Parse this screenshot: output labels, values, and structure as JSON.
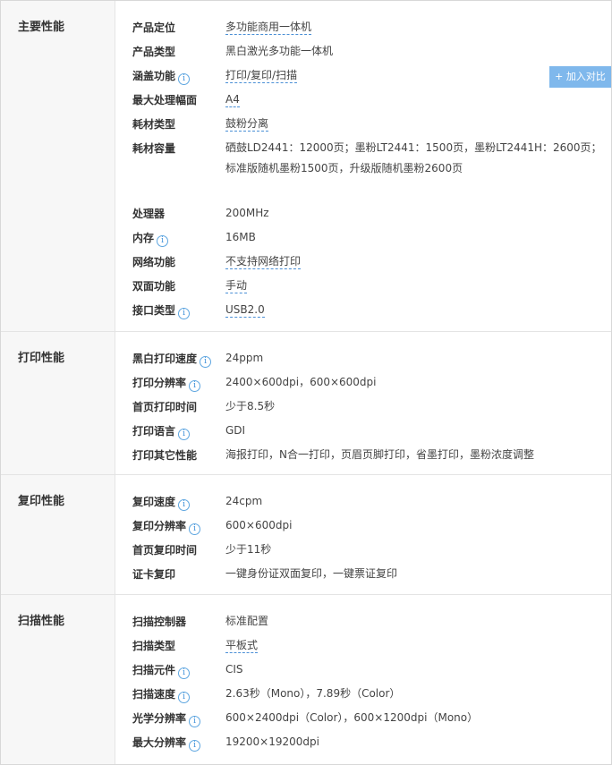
{
  "compare_button": {
    "label": "+ 加入对比"
  },
  "sections": [
    {
      "title": "主要性能",
      "rows": [
        {
          "label": "产品定位",
          "value": "多功能商用一体机",
          "info": false,
          "link": true
        },
        {
          "label": "产品类型",
          "value": "黑白激光多功能一体机",
          "info": false,
          "link": false
        },
        {
          "label": "涵盖功能",
          "value": "打印/复印/扫描",
          "info": true,
          "link": true
        },
        {
          "label": "最大处理幅面",
          "value": "A4",
          "info": false,
          "link": true
        },
        {
          "label": "耗材类型",
          "value": "鼓粉分离",
          "info": false,
          "link": true
        },
        {
          "label": "耗材容量",
          "value": "硒鼓LD2441：12000页；墨粉LT2441：1500页，墨粉LT2441H：2600页；",
          "value2": "标准版随机墨粉1500页，升级版随机墨粉2600页",
          "info": false,
          "link": false
        },
        {
          "label": "处理器",
          "value": "200MHz",
          "info": false,
          "link": false
        },
        {
          "label": "内存",
          "value": "16MB",
          "info": true,
          "link": false
        },
        {
          "label": "网络功能",
          "value": "不支持网络打印",
          "info": false,
          "link": true
        },
        {
          "label": "双面功能",
          "value": "手动",
          "info": false,
          "link": true
        },
        {
          "label": "接口类型",
          "value": "USB2.0",
          "info": true,
          "link": true
        }
      ]
    },
    {
      "title": "打印性能",
      "rows": [
        {
          "label": "黑白打印速度",
          "value": "24ppm",
          "info": true,
          "link": false
        },
        {
          "label": "打印分辨率",
          "value": "2400×600dpi，600×600dpi",
          "info": true,
          "link": false
        },
        {
          "label": "首页打印时间",
          "value": "少于8.5秒",
          "info": false,
          "link": false
        },
        {
          "label": "打印语言",
          "value": "GDI",
          "info": true,
          "link": false
        },
        {
          "label": "打印其它性能",
          "value": "海报打印，N合一打印，页眉页脚打印，省墨打印，墨粉浓度调整",
          "info": false,
          "link": false
        }
      ]
    },
    {
      "title": "复印性能",
      "rows": [
        {
          "label": "复印速度",
          "value": "24cpm",
          "info": true,
          "link": false
        },
        {
          "label": "复印分辨率",
          "value": "600×600dpi",
          "info": true,
          "link": false
        },
        {
          "label": "首页复印时间",
          "value": "少于11秒",
          "info": false,
          "link": false
        },
        {
          "label": "证卡复印",
          "value": "一键身份证双面复印，一键票证复印",
          "info": false,
          "link": false
        }
      ]
    },
    {
      "title": "扫描性能",
      "rows": [
        {
          "label": "扫描控制器",
          "value": "标准配置",
          "info": false,
          "link": false
        },
        {
          "label": "扫描类型",
          "value": "平板式",
          "info": false,
          "link": true
        },
        {
          "label": "扫描元件",
          "value": "CIS",
          "info": true,
          "link": false
        },
        {
          "label": "扫描速度",
          "value": "2.63秒（Mono），7.89秒（Color）",
          "info": true,
          "link": false
        },
        {
          "label": "光学分辨率",
          "value": "600×2400dpi（Color），600×1200dpi（Mono）",
          "info": true,
          "link": false
        },
        {
          "label": "最大分辨率",
          "value": "19200×19200dpi",
          "info": true,
          "link": false
        }
      ]
    }
  ]
}
